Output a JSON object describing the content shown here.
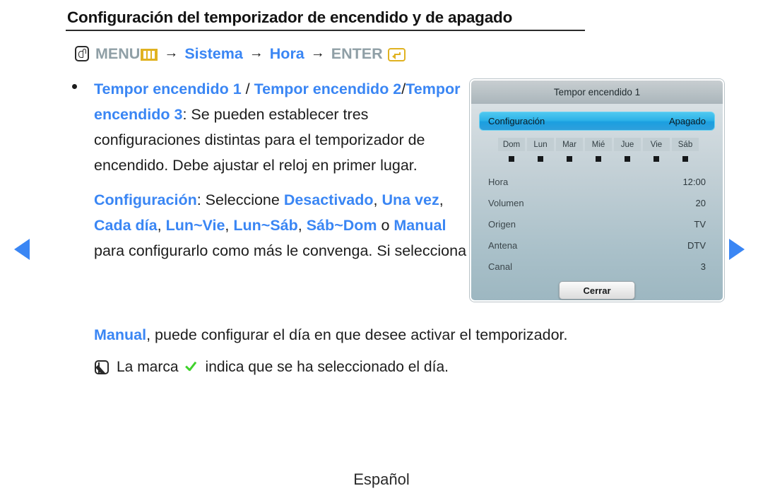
{
  "heading": "Configuración del temporizador de encendido y de apagado",
  "menu_path": {
    "hand_icon": "hand-press-icon",
    "menu_label": "MENU",
    "menu_bars_icon": "menu-bars-icon",
    "arrow": "→",
    "system_label": "Sistema",
    "time_label": "Hora",
    "enter_label": "ENTER",
    "enter_icon": "enter-key-icon"
  },
  "body": {
    "bullet": {
      "t1": "Tempor encendido 1",
      "sep1": " / ",
      "t2": "Tempor encendido 2",
      "sep2": "/",
      "t3": "Tempor encendido 3",
      "rest": ": Se pueden establecer tres configuraciones distintas para el temporizador de encendido. Debe ajustar el reloj en primer lugar."
    },
    "config_para": {
      "label": "Configuración",
      "mid1": ": Seleccione ",
      "opt1": "Desactivado",
      "c1": ", ",
      "opt2": "Una vez",
      "c2": ",  ",
      "opt3": "Cada día",
      "c3": ", ",
      "opt4": "Lun~Vie",
      "c4": ", ",
      "opt5": "Lun~Sáb",
      "c5": ", ",
      "opt6": "Sáb~Dom",
      "mid2": " o ",
      "opt7": "Manual",
      "tail": " para configurarlo como más le convenga. Si selecciona"
    },
    "wide_line": {
      "manual": "Manual",
      "rest": ", puede configurar el día en que desee activar el temporizador."
    },
    "note": {
      "icon": "note-icon",
      "before": "La marca",
      "check_icon": "green-check-icon",
      "after": "indica que se ha seleccionado el día."
    }
  },
  "nav": {
    "prev_icon": "left-triangle-icon",
    "next_icon": "right-triangle-icon"
  },
  "footer": {
    "language": "Español"
  },
  "osd": {
    "title": "Tempor encendido 1",
    "highlight": {
      "label": "Configuración",
      "value": "Apagado"
    },
    "days": [
      {
        "label": "Dom",
        "checked": true
      },
      {
        "label": "Lun",
        "checked": true
      },
      {
        "label": "Mar",
        "checked": true
      },
      {
        "label": "Mié",
        "checked": true
      },
      {
        "label": "Jue",
        "checked": true
      },
      {
        "label": "Vie",
        "checked": true
      },
      {
        "label": "Sáb",
        "checked": true
      }
    ],
    "rows": [
      {
        "label": "Hora",
        "value": "12:00"
      },
      {
        "label": "Volumen",
        "value": "20"
      },
      {
        "label": "Origen",
        "value": "TV"
      },
      {
        "label": "Antena",
        "value": "DTV"
      },
      {
        "label": "Canal",
        "value": "3"
      }
    ],
    "close_button": "Cerrar"
  },
  "colors": {
    "accent_blue": "#3a86f4",
    "gold": "#e0b221",
    "gray_label": "#8f9fa6",
    "check_green": "#3fd22b",
    "osd_highlight": "#2eb3e8"
  }
}
